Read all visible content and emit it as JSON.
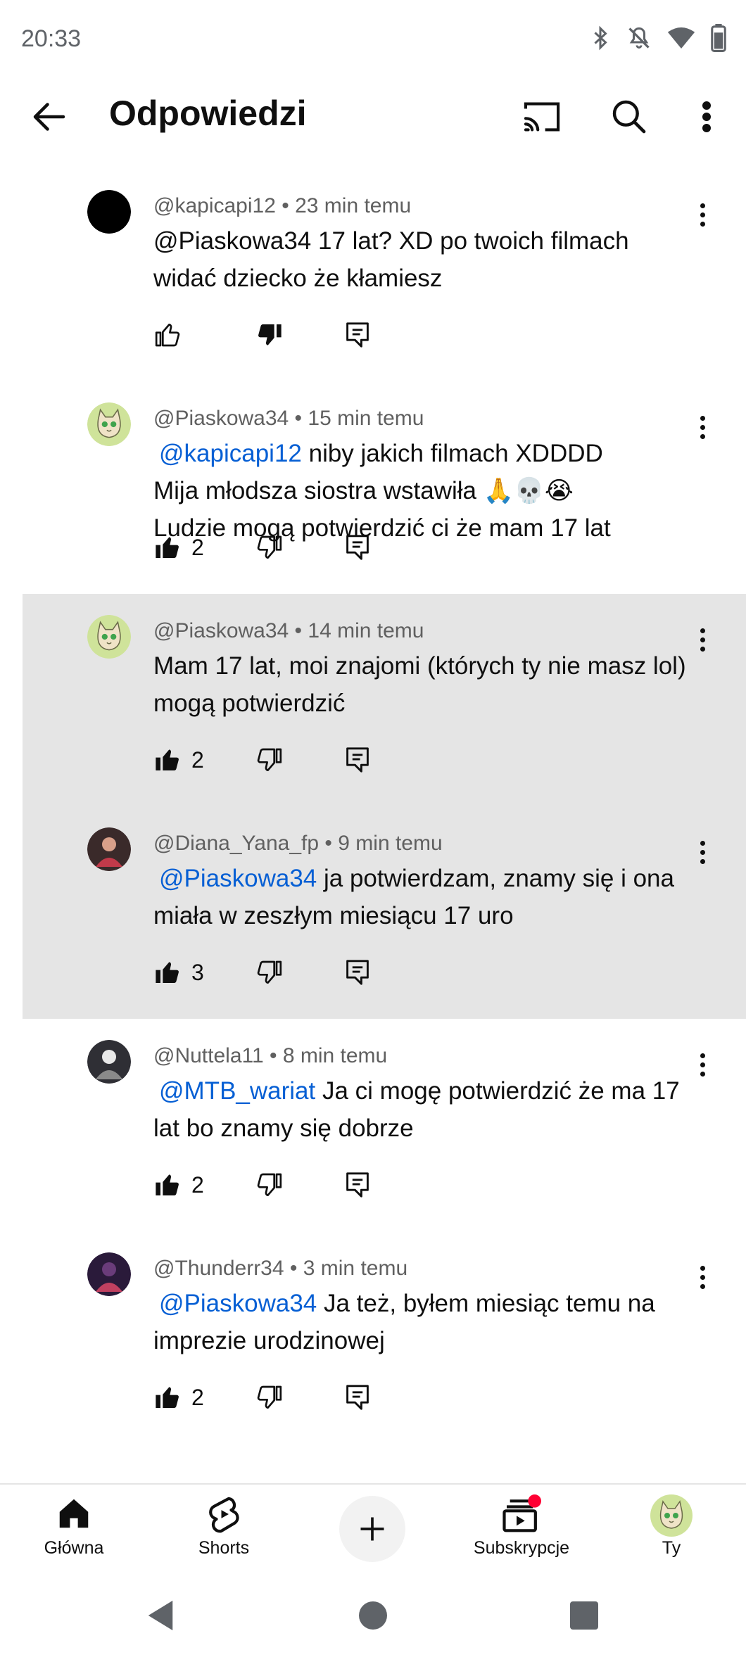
{
  "status": {
    "time": "20:33"
  },
  "header": {
    "title": "Odpowiedzi"
  },
  "comments": [
    {
      "author": "@kapicapi12",
      "time": "23 min temu",
      "avatar": "black-circle-avatar",
      "mention": "",
      "text": "@Piaskowa34  17 lat? XD po twoich filmach widać dziecko że kłamiesz",
      "likes": "",
      "liked": false,
      "disliked": true,
      "highlight": false
    },
    {
      "author": "@Piaskowa34",
      "time": "15 min temu",
      "avatar": "cat-avatar",
      "mention": "@kapicapi12",
      "text": "  niby jakich filmach XDDDD\nMija młodsza siostra wstawiła 🙏💀😭\nLudzie mogą potwierdzić ci że mam 17 lat",
      "likes": "2",
      "liked": true,
      "disliked": false,
      "highlight": false
    },
    {
      "author": "@Piaskowa34",
      "time": "14 min temu",
      "avatar": "cat-avatar",
      "mention": "",
      "text": "Mam 17 lat, moi znajomi (których ty nie masz lol) mogą potwierdzić",
      "likes": "2",
      "liked": true,
      "disliked": false,
      "highlight": true
    },
    {
      "author": "@Diana_Yana_fp",
      "time": "9 min temu",
      "avatar": "photo-avatar",
      "mention": "@Piaskowa34",
      "text": " ja potwierdzam, znamy się i ona miała w zeszłym miesiącu 17 uro",
      "likes": "3",
      "liked": true,
      "disliked": false,
      "highlight": true
    },
    {
      "author": "@Nuttela11",
      "time": "8 min temu",
      "avatar": "photo-avatar",
      "mention": "@MTB_wariat",
      "text": "  Ja ci mogę potwierdzić że ma 17 lat bo znamy się dobrze",
      "likes": "2",
      "liked": true,
      "disliked": false,
      "highlight": false
    },
    {
      "author": "@Thunderr34",
      "time": "3 min temu",
      "avatar": "photo-avatar",
      "mention": "@Piaskowa34",
      "text": "  Ja też, byłem miesiąc temu na imprezie urodzinowej",
      "likes": "2",
      "liked": true,
      "disliked": false,
      "highlight": false
    }
  ],
  "nav": {
    "home": "Główna",
    "shorts": "Shorts",
    "subscriptions": "Subskrypcje",
    "you": "Ty"
  },
  "colors": {
    "mention": "#065fd4",
    "highlight_bg": "#e5e5e5",
    "notification_dot": "#ff0033"
  }
}
